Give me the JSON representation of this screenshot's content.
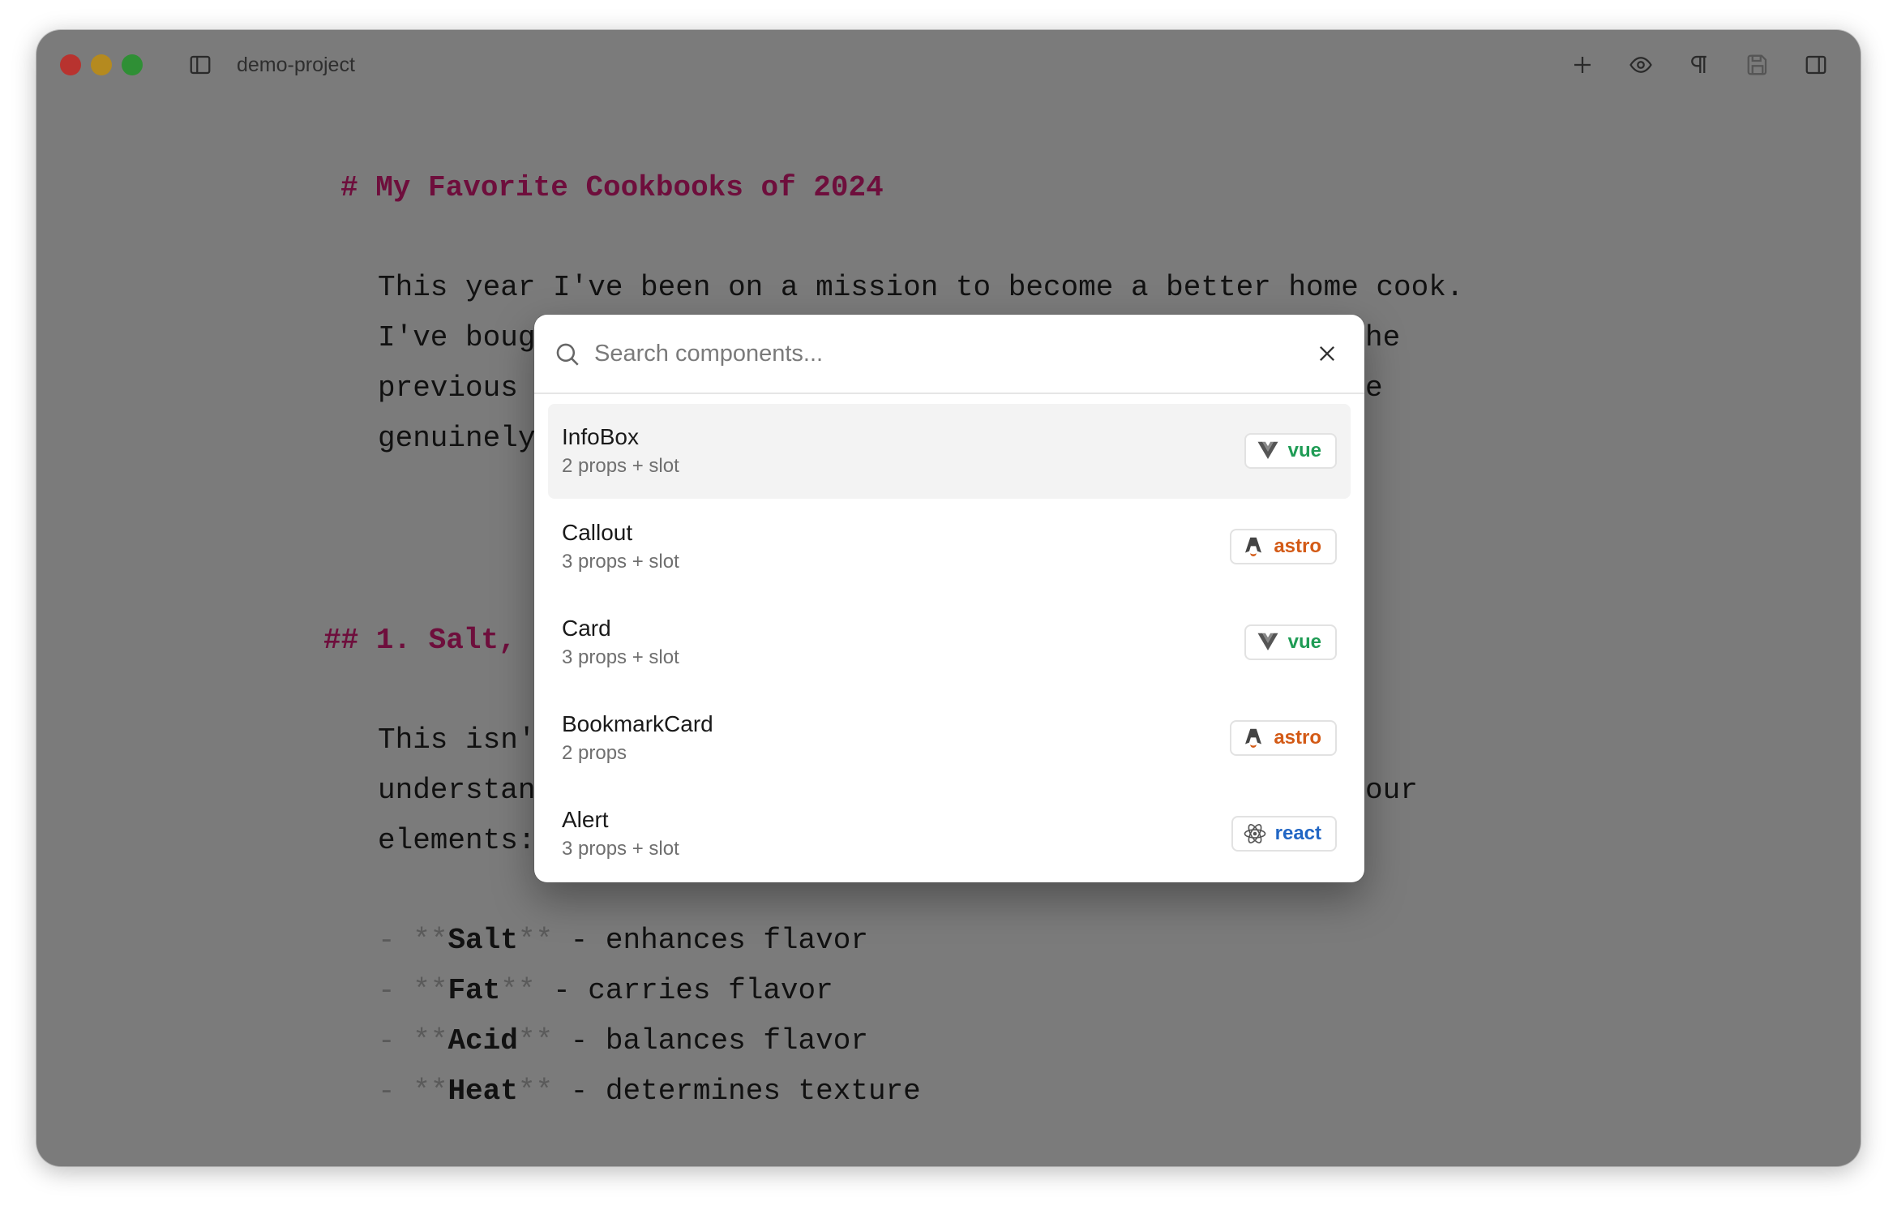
{
  "window": {
    "title": "demo-project",
    "toolbar_icons": [
      "sidebar-toggle-icon",
      "plus-icon",
      "eye-icon",
      "pilcrow-icon",
      "save-icon",
      "panel-right-icon"
    ]
  },
  "editor": {
    "h1": "# My Favorite Cookbooks of 2024",
    "p1_line1": "This year I've been on a mission to become a better home cook.",
    "p1_line2_start": "I've boug",
    "p1_line2_end": "he",
    "p1_line3_start": "previous ",
    "p1_line3_end": "e",
    "p1_line4_start": "genuinely",
    "h2": "## 1. Salt,",
    "p2_line1_start": "This isn'",
    "p2_line2_start": "understan",
    "p2_line2_end": "our",
    "p2_line3_start": "elements:",
    "list": [
      {
        "dash": "-",
        "open": "**",
        "bold": "Salt",
        "close": "**",
        "rest": " - enhances flavor"
      },
      {
        "dash": "-",
        "open": "**",
        "bold": "Fat",
        "close": "**",
        "rest": " - carries flavor"
      },
      {
        "dash": "-",
        "open": "**",
        "bold": "Acid",
        "close": "**",
        "rest": " - balances flavor"
      },
      {
        "dash": "-",
        "open": "**",
        "bold": "Heat",
        "close": "**",
        "rest": " - determines texture"
      }
    ]
  },
  "search": {
    "placeholder": "Search components...",
    "value": ""
  },
  "components": [
    {
      "name": "InfoBox",
      "meta": "2 props + slot",
      "framework": "vue"
    },
    {
      "name": "Callout",
      "meta": "3 props + slot",
      "framework": "astro"
    },
    {
      "name": "Card",
      "meta": "3 props + slot",
      "framework": "vue"
    },
    {
      "name": "BookmarkCard",
      "meta": "2 props",
      "framework": "astro"
    },
    {
      "name": "Alert",
      "meta": "3 props + slot",
      "framework": "react"
    }
  ],
  "colors": {
    "heading": "#6e0e3c",
    "vue": "#1f9c55",
    "astro": "#d35a16",
    "react": "#2166c4",
    "overlay": "#7b7b7b"
  }
}
